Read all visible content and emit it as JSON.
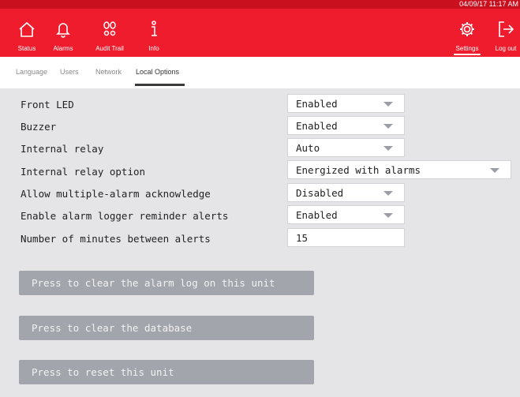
{
  "header": {
    "datetime": "04/09/17 11:17 AM",
    "nav": [
      {
        "id": "status",
        "label": "Status",
        "icon": "home-icon"
      },
      {
        "id": "alarms",
        "label": "Alarms",
        "icon": "bell-icon"
      },
      {
        "id": "audit",
        "label": "Audit Trail",
        "icon": "footprints-icon"
      },
      {
        "id": "info",
        "label": "Info",
        "icon": "info-icon"
      }
    ],
    "settings_label": "Settings",
    "logout_label": "Log out"
  },
  "tabs": [
    {
      "label": "Language"
    },
    {
      "label": "Users"
    },
    {
      "label": "Network"
    },
    {
      "label": "Local Options",
      "active": true
    }
  ],
  "options": [
    {
      "label": "Front LED",
      "value": "Enabled",
      "type": "select"
    },
    {
      "label": "Buzzer",
      "value": "Enabled",
      "type": "select"
    },
    {
      "label": "Internal relay",
      "value": "Auto",
      "type": "select"
    },
    {
      "label": "Internal relay option",
      "value": "Energized with alarms",
      "type": "select"
    },
    {
      "label": "Allow multiple-alarm acknowledge",
      "value": "Disabled",
      "type": "select"
    },
    {
      "label": "Enable alarm logger reminder alerts",
      "value": "Enabled",
      "type": "select"
    },
    {
      "label": "Number of minutes between alerts",
      "value": "15",
      "type": "input"
    }
  ],
  "buttons": {
    "clear_log": "Press to clear the alarm log on this unit",
    "clear_db": "Press to clear the database",
    "reset": "Press to reset this unit"
  },
  "colors": {
    "accent": "#ee1c2d",
    "panel": "#e5e5e8",
    "button": "#a2a5ab"
  }
}
